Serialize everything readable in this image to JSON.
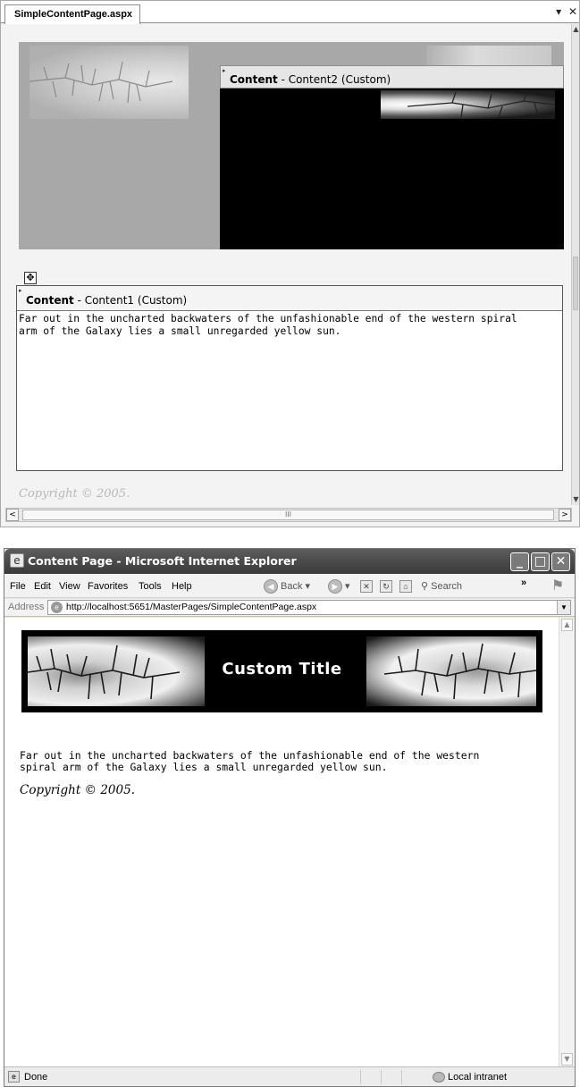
{
  "designer": {
    "tab_label": "SimpleContentPage.aspx",
    "tab_pin": "▾",
    "tab_close": "✕",
    "content2": {
      "kind": "Content",
      "label": " - Content2 (Custom)"
    },
    "content1": {
      "kind": "Content",
      "label": " - Content1 (Custom)",
      "text": "Far out in the uncharted backwaters of the unfashionable end of the western spiral\narm of the Galaxy lies a small unregarded yellow sun."
    },
    "copyright": "Copyright © 2005.",
    "scroll_left": "<",
    "scroll_right": ">",
    "scroll_grip": "III"
  },
  "browser": {
    "title": "Content Page - Microsoft Internet Explorer",
    "menu": {
      "file": "File",
      "edit": "Edit",
      "view": "View",
      "favorites": "Favorites",
      "tools": "Tools",
      "help": "Help"
    },
    "toolbar": {
      "back": "Back",
      "search": "Search",
      "more": "»"
    },
    "address_label": "Address",
    "address_url": "http://localhost:5651/MasterPages/SimpleContentPage.aspx",
    "page": {
      "banner_title": "Custom Title",
      "body_text": "Far out in the uncharted backwaters of the unfashionable end of the western\nspiral arm of the Galaxy lies a small unregarded yellow sun.",
      "copyright": "Copyright © 2005."
    },
    "status": {
      "text": "Done",
      "zone": "Local intranet"
    }
  },
  "colors": {
    "banner_bg": "#000000",
    "designer_bg": "#f3f3f3",
    "master_area": "#a8a8a8",
    "titlebar": "#4a4a4a"
  }
}
